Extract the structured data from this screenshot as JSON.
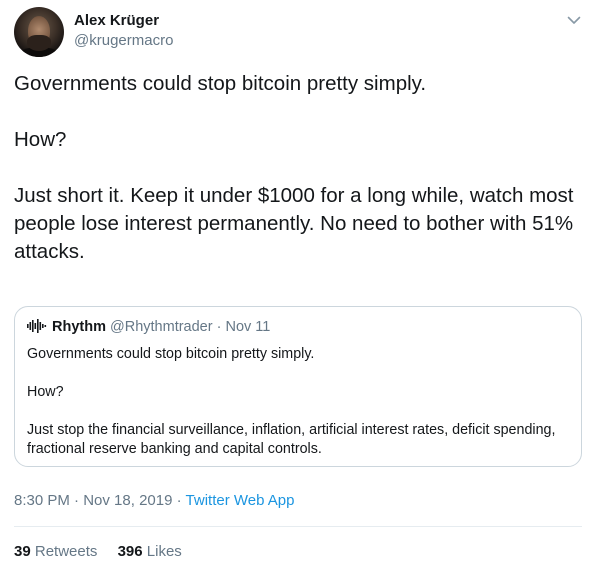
{
  "author": {
    "name": "Alex Krüger",
    "handle": "@krugermacro"
  },
  "tweet": {
    "line1": "Governments could stop bitcoin pretty simply.",
    "line2": "How?",
    "line3": "Just short it. Keep it under $1000 for a long while, watch most people lose interest permanently. No need to bother with 51% attacks."
  },
  "quote": {
    "name": "Rhythm",
    "handle": "@Rhythmtrader",
    "separator": "·",
    "date": "Nov 11",
    "line1": "Governments could stop bitcoin pretty simply.",
    "line2": "How?",
    "line3": "Just stop the financial surveillance, inflation, artificial interest rates, deficit spending, fractional reserve banking and capital controls."
  },
  "meta": {
    "time": "8:30 PM",
    "date": "Nov 18, 2019",
    "separator": "·",
    "app": "Twitter Web App"
  },
  "stats": {
    "retweets_count": "39",
    "retweets_label": "Retweets",
    "likes_count": "396",
    "likes_label": "Likes"
  },
  "colors": {
    "text": "#14171a",
    "secondary": "#657786",
    "link": "#1b95e0",
    "border": "#ccd6dd"
  }
}
